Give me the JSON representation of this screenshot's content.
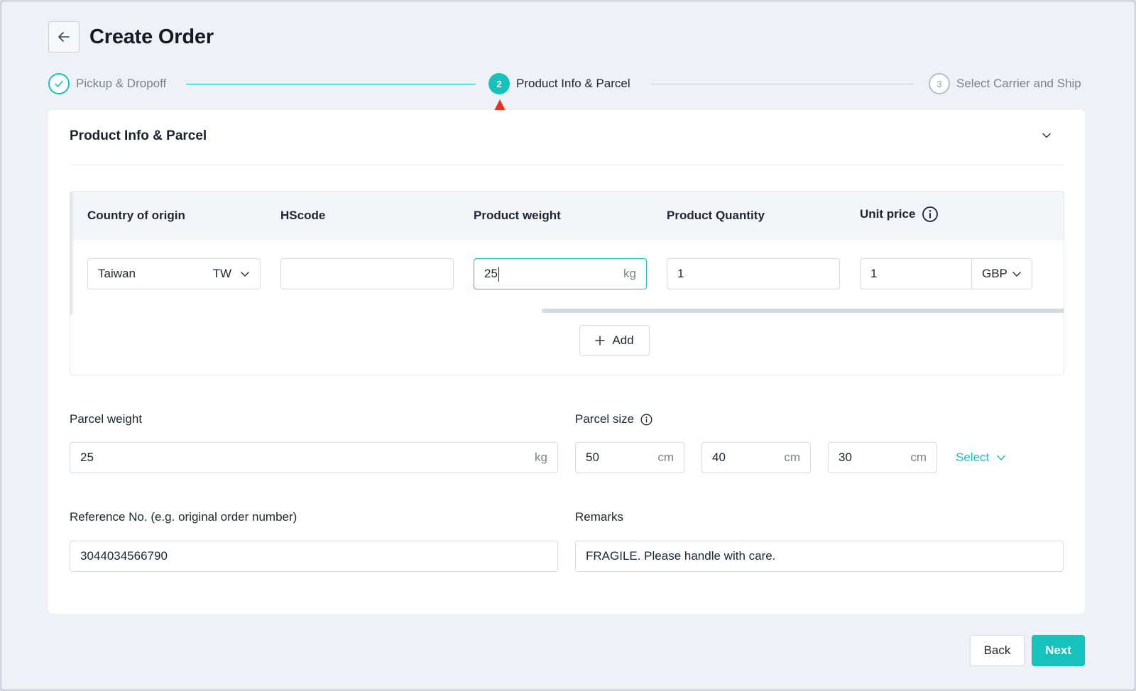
{
  "header": {
    "title": "Create Order",
    "back_icon": "arrow-left-icon"
  },
  "stepper": {
    "steps": [
      {
        "number": "1",
        "label": "Pickup & Dropoff",
        "status": "completed"
      },
      {
        "number": "2",
        "label": "Product Info & Parcel",
        "status": "active"
      },
      {
        "number": "3",
        "label": "Select Carrier and Ship",
        "status": "pending"
      }
    ]
  },
  "section": {
    "title": "Product Info & Parcel",
    "collapse_icon": "chevron-down-icon"
  },
  "product_table": {
    "headers": {
      "country": "Country of origin",
      "hscode": "HScode",
      "weight": "Product weight",
      "quantity": "Product Quantity",
      "unit_price": "Unit price"
    },
    "row": {
      "country_name": "Taiwan",
      "country_code": "TW",
      "hscode": "",
      "weight": "25",
      "weight_unit": "kg",
      "quantity": "1",
      "unit_price": "1",
      "currency": "GBP"
    },
    "add_label": "Add"
  },
  "parcel": {
    "weight_label": "Parcel weight",
    "weight_value": "25",
    "weight_unit": "kg",
    "size_label": "Parcel size",
    "length": "50",
    "width": "40",
    "height": "30",
    "size_unit": "cm",
    "select_label": "Select"
  },
  "reference": {
    "label": "Reference No. (e.g. original order number)",
    "value": "3044034566790"
  },
  "remarks": {
    "label": "Remarks",
    "value": "FRAGILE. Please handle with care."
  },
  "footer": {
    "back_label": "Back",
    "next_label": "Next"
  },
  "colors": {
    "accent": "#17c2bd",
    "annotation": "#e8321e"
  }
}
